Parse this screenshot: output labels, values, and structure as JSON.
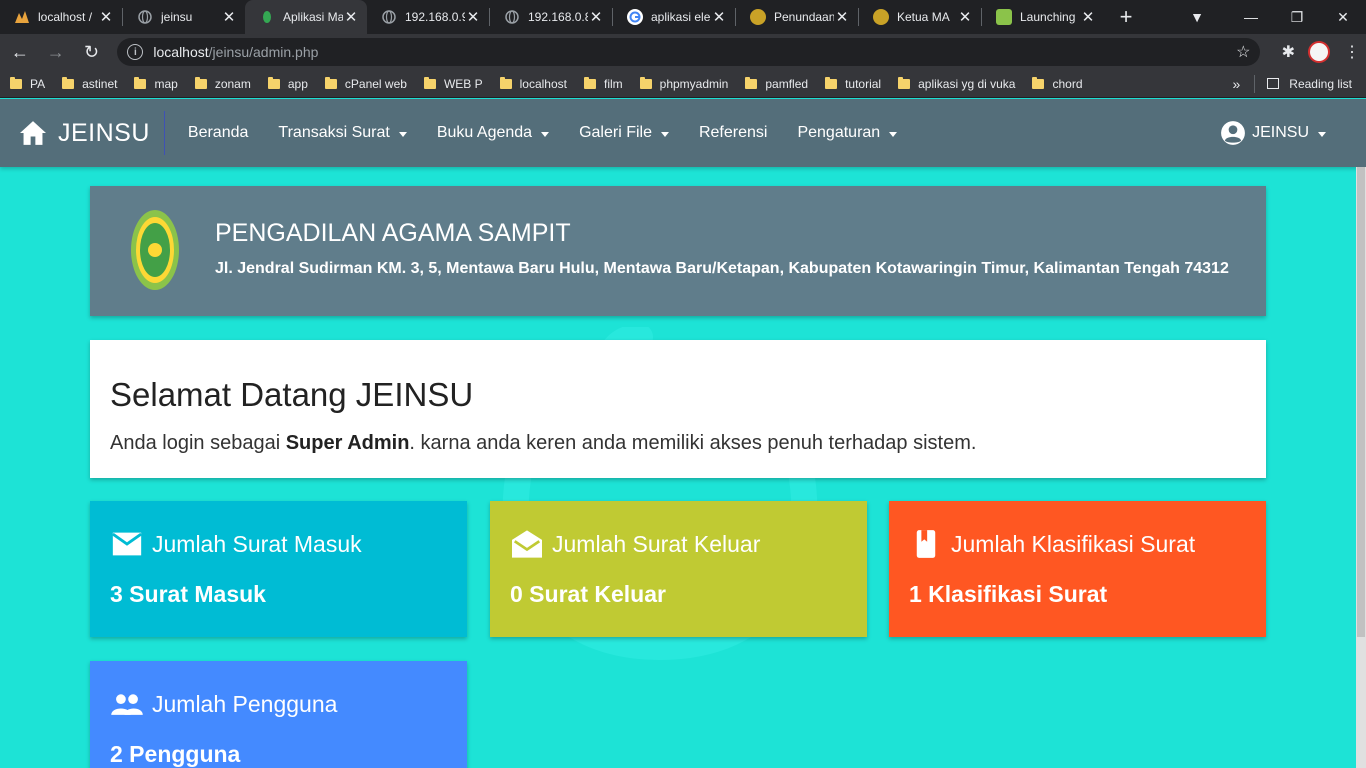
{
  "browser": {
    "tabs": [
      {
        "title": "localhost /",
        "icon": "phpmyadmin-icon",
        "color": "#e8a33d"
      },
      {
        "title": "jeinsu",
        "icon": "globe-icon",
        "color": "#9aa0a6"
      },
      {
        "title": "Aplikasi Ma",
        "icon": "leaf-icon",
        "color": "#34a853"
      },
      {
        "title": "192.168.0.9",
        "icon": "globe-icon",
        "color": "#9aa0a6"
      },
      {
        "title": "192.168.0.8",
        "icon": "globe-icon",
        "color": "#9aa0a6"
      },
      {
        "title": "aplikasi ele",
        "icon": "google-icon",
        "color": "#ffffff"
      },
      {
        "title": "Penundaan",
        "icon": "seal-icon",
        "color": "#c9a227"
      },
      {
        "title": "Ketua MA",
        "icon": "seal-icon",
        "color": "#c9a227"
      },
      {
        "title": "Launching",
        "icon": "emblem-icon",
        "color": "#8bc34a"
      }
    ],
    "active_tab": 2,
    "url_host": "localhost",
    "url_path": "/jeinsu/admin.php",
    "bookmarks": [
      "PA",
      "astinet",
      "map",
      "zonam",
      "app",
      "cPanel web",
      "WEB P",
      "localhost",
      "film",
      "phpmyadmin",
      "pamfled",
      "tutorial",
      "aplikasi yg di vuka",
      "chord"
    ],
    "reading_list": "Reading list"
  },
  "app": {
    "brand": "JEINSU",
    "menu": [
      {
        "label": "Beranda",
        "dropdown": false
      },
      {
        "label": "Transaksi Surat",
        "dropdown": true
      },
      {
        "label": "Buku Agenda",
        "dropdown": true
      },
      {
        "label": "Galeri File",
        "dropdown": true
      },
      {
        "label": "Referensi",
        "dropdown": false
      },
      {
        "label": "Pengaturan",
        "dropdown": true
      }
    ],
    "user": "JEINSU"
  },
  "header": {
    "name": "PENGADILAN AGAMA SAMPIT",
    "address": "Jl. Jendral Sudirman KM. 3, 5, Mentawa Baru Hulu, Mentawa Baru/Ketapan, Kabupaten Kotawaringin Timur, Kalimantan Tengah 74312"
  },
  "welcome": {
    "title": "Selamat Datang JEINSU",
    "text_before": "Anda login sebagai ",
    "role": "Super Admin",
    "text_after": ". karna anda keren anda memiliki akses penuh terhadap sistem."
  },
  "stats": [
    {
      "title": "Jumlah Surat Masuk",
      "value": "3 Surat Masuk",
      "icon": "mail-icon",
      "color": "#00bcd4"
    },
    {
      "title": "Jumlah Surat Keluar",
      "value": "0 Surat Keluar",
      "icon": "drafts-icon",
      "color": "#c0ca33"
    },
    {
      "title": "Jumlah Klasifikasi Surat",
      "value": "1 Klasifikasi Surat",
      "icon": "book-icon",
      "color": "#ff5722"
    },
    {
      "title": "Jumlah Pengguna",
      "value": "2 Pengguna",
      "icon": "people-icon",
      "color": "#448aff"
    }
  ],
  "colors": {
    "page_bg": "#1de3d6",
    "navbar": "#546e7a",
    "header_card": "#607d8b"
  }
}
